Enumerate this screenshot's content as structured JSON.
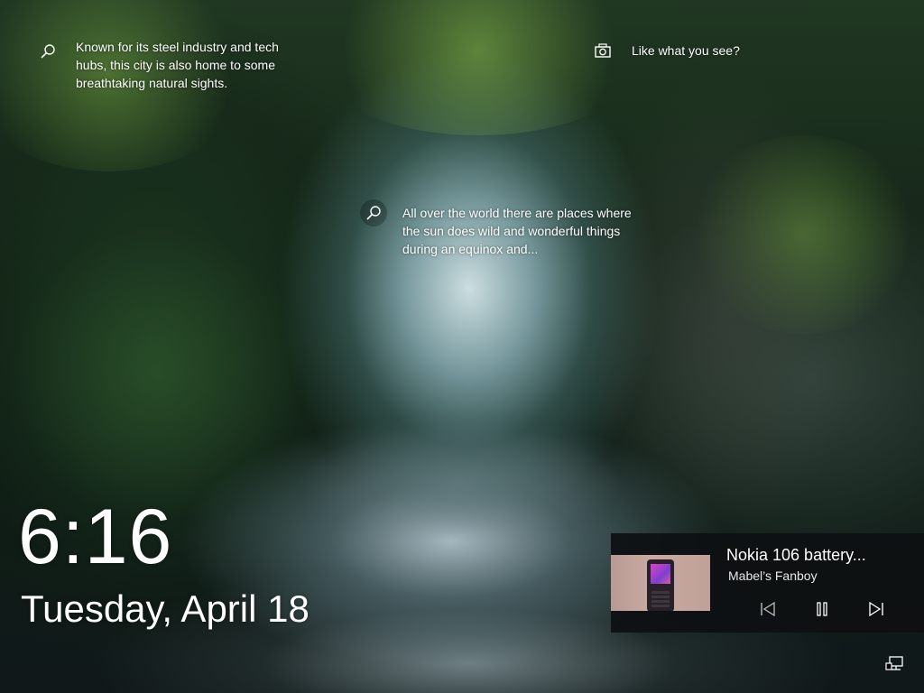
{
  "spotlight": {
    "top_tip": "Known for its steel industry and tech\nhubs, this city is also home to some\nbreathtaking natural sights.",
    "center_tip": "All over the world there are places where\nthe sun does wild and wonderful things\nduring an equinox and...",
    "like_label": "Like what you see?"
  },
  "clock": {
    "time": "6:16",
    "date": "Tuesday, April 18"
  },
  "media": {
    "title": "Nokia 106 battery...",
    "artist": "Mabel’s Fanboy"
  },
  "icons": {
    "search": "search-icon",
    "camera": "camera-icon",
    "previous": "skip-previous-icon",
    "pause": "pause-icon",
    "next": "skip-next-icon",
    "network": "network-icon"
  }
}
